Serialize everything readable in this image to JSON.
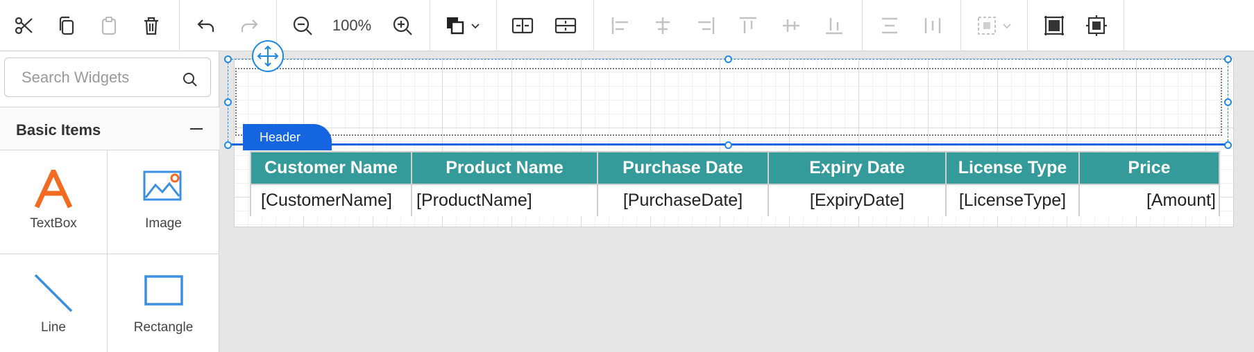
{
  "toolbar": {
    "zoom": "100%"
  },
  "sidebar": {
    "search_placeholder": "Search Widgets",
    "section_title": "Basic Items",
    "widgets": [
      {
        "label": "TextBox",
        "icon": "textbox-icon"
      },
      {
        "label": "Image",
        "icon": "image-icon"
      },
      {
        "label": "Line",
        "icon": "line-icon"
      },
      {
        "label": "Rectangle",
        "icon": "rectangle-icon"
      }
    ]
  },
  "designer": {
    "header_label": "Header",
    "table": {
      "columns": [
        "Customer Name",
        "Product Name",
        "Purchase Date",
        "Expiry Date",
        "License Type",
        "Price"
      ],
      "row": [
        "[CustomerName]",
        "[ProductName]",
        "[PurchaseDate]",
        "[ExpiryDate]",
        "[LicenseType]",
        "[Amount]"
      ]
    }
  },
  "colors": {
    "accent": "#1565e0",
    "table_header": "#349a9a",
    "widget_icon_orange": "#f26b21",
    "widget_icon_blue": "#3b8fe0"
  }
}
